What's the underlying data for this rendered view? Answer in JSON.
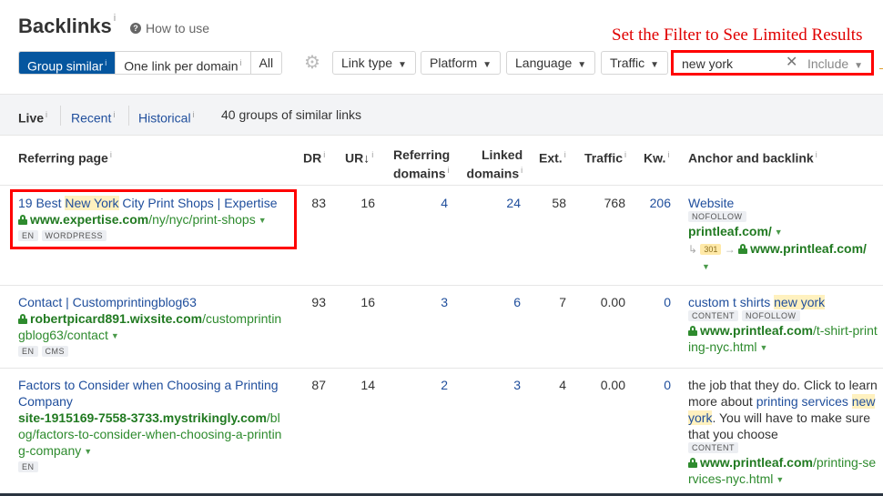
{
  "header": {
    "title": "Backlinks",
    "title_info": "i",
    "how_to_use": "How to use"
  },
  "annotation": "Set the Filter to See Limited Results",
  "toolbar": {
    "grouping": [
      {
        "label": "Group similar",
        "info": "i",
        "active": true
      },
      {
        "label": "One link per domain",
        "info": "i",
        "active": false
      },
      {
        "label": "All",
        "info": "",
        "active": false
      }
    ],
    "dropdowns": {
      "link_type": "Link type",
      "platform": "Platform",
      "language": "Language",
      "traffic": "Traffic"
    },
    "filter": {
      "value": "new york",
      "mode": "Include"
    }
  },
  "tabs": {
    "live": "Live",
    "recent": "Recent",
    "historical": "Historical",
    "summary": "40 groups of similar links"
  },
  "columns": {
    "referring_page": "Referring page",
    "dr": "DR",
    "ur": "UR",
    "ur_sort": "↓",
    "ref_domains_1": "Referring",
    "ref_domains_2": "domains",
    "linked_domains_1": "Linked",
    "linked_domains_2": "domains",
    "ext": "Ext.",
    "traffic": "Traffic",
    "kw": "Kw.",
    "anchor": "Anchor and backlink"
  },
  "rows": [
    {
      "title_pre": "19 Best ",
      "title_hl": "New York",
      "title_post": " City Print Shops | Expertise",
      "url_domain": "www.expertise.com",
      "url_path": "/ny/nyc/print-shops",
      "secure": true,
      "badges": [
        "EN",
        "WORDPRESS"
      ],
      "dr": "83",
      "ur": "16",
      "ref_domains": "4",
      "linked_domains": "24",
      "ext": "58",
      "traffic": "768",
      "kw": "206",
      "anchor_text": "Website",
      "anchor_badges": [
        "NOFOLLOW"
      ],
      "backlink_domain": "printleaf.com",
      "backlink_path": "/",
      "redirect_code": "301",
      "redirect_domain": "www.printleaf.com",
      "redirect_path": "/"
    },
    {
      "title_pre": "Contact | Customprintingblog63",
      "url_domain": "robertpicard891.wixsite.com",
      "url_path": "/customprintingblog63/contact",
      "secure": true,
      "badges": [
        "EN",
        "CMS"
      ],
      "dr": "93",
      "ur": "16",
      "ref_domains": "3",
      "linked_domains": "6",
      "ext": "7",
      "traffic": "0.00",
      "kw": "0",
      "anchor_pre": "custom t shirts ",
      "anchor_hl": "new york",
      "anchor_badges": [
        "CONTENT",
        "NOFOLLOW"
      ],
      "backlink_domain": "www.printleaf.com",
      "backlink_path": "/t-shirt-printing-nyc.html"
    },
    {
      "title_pre": "Factors to Consider when Choosing a Printing Company",
      "url_domain": "site-1915169-7558-3733.mystrikingly.com",
      "url_path": "/blog/factors-to-consider-when-choosing-a-printing-company",
      "secure": false,
      "badges": [
        "EN"
      ],
      "dr": "87",
      "ur": "14",
      "ref_domains": "2",
      "linked_domains": "3",
      "ext": "4",
      "traffic": "0.00",
      "kw": "0",
      "anchor_ctx_pre": "the job that they do. Click to learn more about ",
      "anchor_link_pre": "printing services ",
      "anchor_hl": "new york",
      "anchor_ctx_post": ". You will have to make sure that you choose",
      "anchor_badges": [
        "CONTENT"
      ],
      "backlink_domain": "www.printleaf.com",
      "backlink_path": "/printing-services-nyc.html"
    }
  ],
  "colors": {
    "accent": "#05569f",
    "link": "#1f4e9c",
    "url_green": "#2e8b2e",
    "highlight": "#fff1bf",
    "annotation_red": "#ff0000"
  }
}
